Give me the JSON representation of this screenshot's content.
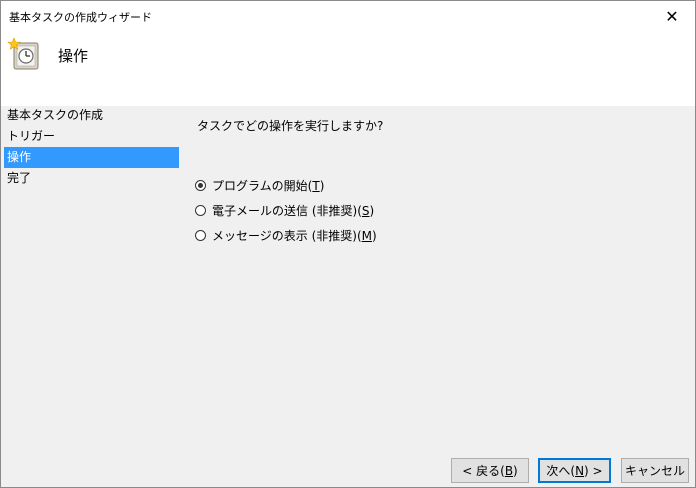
{
  "window": {
    "title": "基本タスクの作成ウィザード"
  },
  "header": {
    "title": "操作",
    "icon": "task-clock-icon"
  },
  "nav": {
    "items": [
      {
        "label": "基本タスクの作成",
        "selected": false
      },
      {
        "label": "トリガー",
        "selected": false
      },
      {
        "label": "操作",
        "selected": true
      },
      {
        "label": "完了",
        "selected": false
      }
    ]
  },
  "main": {
    "question": "タスクでどの操作を実行しますか?",
    "options": [
      {
        "label": "プログラムの開始",
        "accel": "T",
        "checked": true
      },
      {
        "label": "電子メールの送信 (非推奨)",
        "accel": "S",
        "checked": false
      },
      {
        "label": "メッセージの表示 (非推奨)",
        "accel": "M",
        "checked": false
      }
    ]
  },
  "buttons": {
    "back": {
      "prefix": "< 戻る(",
      "accel": "B",
      "suffix": ")"
    },
    "next": {
      "prefix": "次へ(",
      "accel": "N",
      "suffix": ") >"
    },
    "cancel": "キャンセル"
  },
  "colors": {
    "selection": "#3399ff",
    "default_button_border": "#0078d7",
    "panel_bg": "#f0f0f0"
  }
}
